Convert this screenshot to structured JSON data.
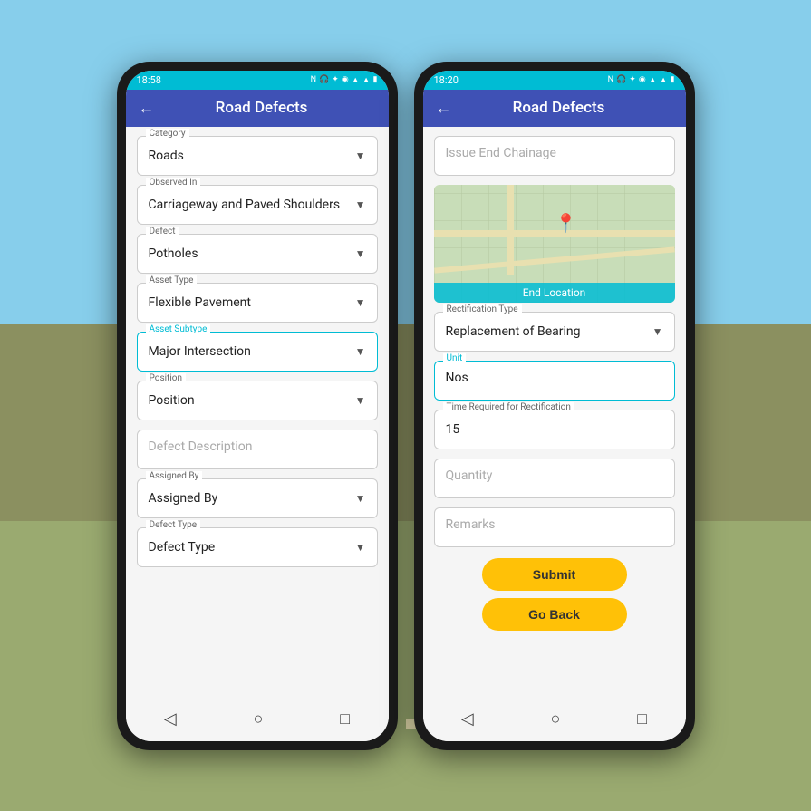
{
  "scene": {
    "background": "road with sky"
  },
  "phone1": {
    "status_bar": {
      "time": "18:58",
      "icons": "📶🔵⬡🔵🛰📶📶🔋"
    },
    "header": {
      "title": "Road Defects",
      "back_label": "←"
    },
    "nav": {
      "back": "◁",
      "home": "○",
      "recent": "□"
    },
    "fields": [
      {
        "label": "Category",
        "value": "Roads",
        "has_dropdown": true,
        "active": false
      },
      {
        "label": "Observed In",
        "value": "Carriageway and Paved Shoulders",
        "has_dropdown": true,
        "active": false
      },
      {
        "label": "Defect",
        "value": "Potholes",
        "has_dropdown": true,
        "active": false
      },
      {
        "label": "Asset Type",
        "value": "Flexible Pavement",
        "has_dropdown": true,
        "active": false
      },
      {
        "label": "Asset Subtype",
        "value": "Major Intersection",
        "has_dropdown": true,
        "active": true
      },
      {
        "label": "Position",
        "value": "Position",
        "has_dropdown": true,
        "active": false
      },
      {
        "label": "",
        "value": "Defect Description",
        "has_dropdown": false,
        "active": false,
        "placeholder": true
      },
      {
        "label": "Assigned By",
        "value": "Assigned By",
        "has_dropdown": true,
        "active": false
      },
      {
        "label": "Defect Type",
        "value": "Defect Type",
        "has_dropdown": true,
        "active": false
      }
    ]
  },
  "phone2": {
    "status_bar": {
      "time": "18:20",
      "icons": "📶🎧🛰🔵📶📶🔋"
    },
    "header": {
      "title": "Road Defects",
      "back_label": "←"
    },
    "nav": {
      "back": "◁",
      "home": "○",
      "recent": "□"
    },
    "fields": [
      {
        "label": "",
        "value": "Issue End Chainage",
        "has_dropdown": false,
        "active": false,
        "placeholder": true
      },
      {
        "map": true
      },
      {
        "label": "Rectification Type",
        "value": "Replacement of Bearing",
        "has_dropdown": true,
        "active": false
      },
      {
        "label": "Unit",
        "value": "Nos",
        "has_dropdown": false,
        "active": true
      },
      {
        "label": "Time Required for Rectification",
        "value": "15",
        "has_dropdown": false,
        "active": false
      },
      {
        "label": "",
        "value": "Quantity",
        "has_dropdown": false,
        "active": false,
        "placeholder": true
      },
      {
        "label": "",
        "value": "Remarks",
        "has_dropdown": false,
        "active": false,
        "placeholder": true
      }
    ],
    "buttons": {
      "submit": "Submit",
      "go_back": "Go Back"
    }
  }
}
